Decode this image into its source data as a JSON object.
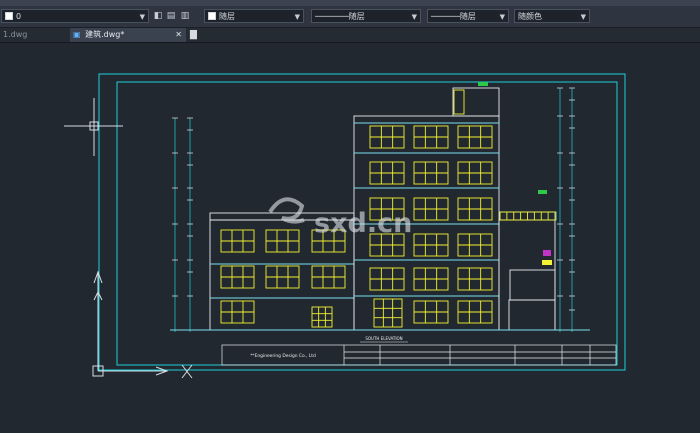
{
  "toolbar": {
    "layer_value": "0",
    "color_value": "随层",
    "linetype_value": "随层",
    "lineweight_value": "随层",
    "plotstyle_value": "随颜色"
  },
  "tabs": [
    {
      "label": "1.dwg",
      "active": false
    },
    {
      "label": "建筑.dwg*",
      "active": true
    }
  ],
  "drawing": {
    "view_title": "SOUTH ELEVATION",
    "company": "**Engineering Design Co., Ltd",
    "watermark_text": "sxd.cn",
    "colors": {
      "frame": "#1fd0d8",
      "window": "#f5f231",
      "wall": "#e8ecef",
      "accent": "#7be0ee",
      "green": "#2ec94a",
      "magenta": "#c234c8",
      "background": "#212830"
    }
  }
}
